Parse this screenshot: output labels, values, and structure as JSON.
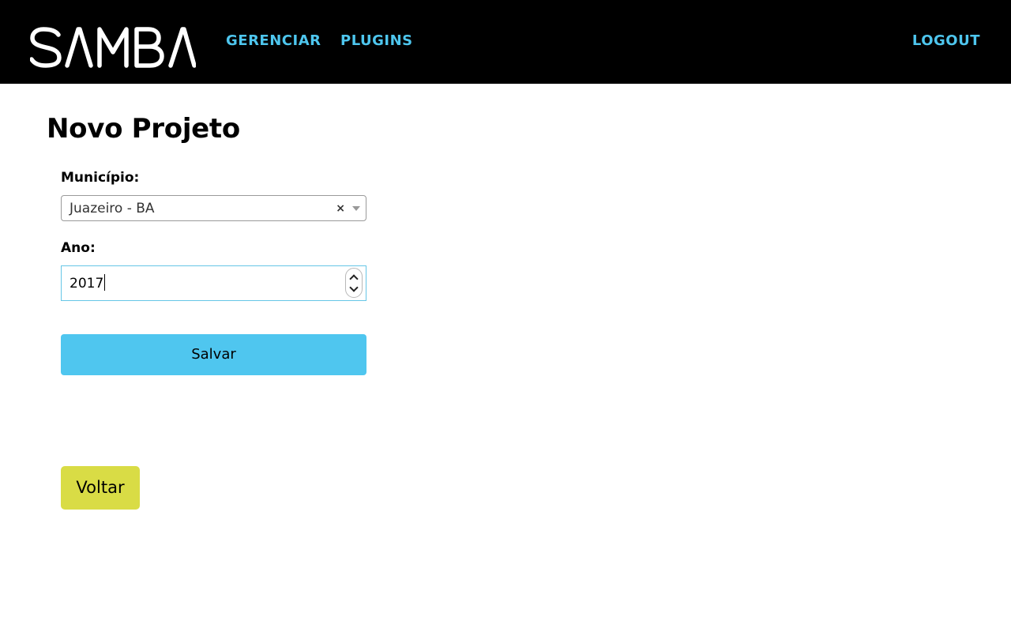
{
  "nav": {
    "logo_text": "SAMBA",
    "links": [
      {
        "label": "GERENCIAR"
      },
      {
        "label": "PLUGINS"
      },
      {
        "label": "LOGOUT"
      }
    ]
  },
  "page": {
    "title": "Novo Projeto"
  },
  "form": {
    "municipio": {
      "label": "Município:",
      "selected_value": "Juazeiro - BA",
      "clear_icon": "×"
    },
    "ano": {
      "label": "Ano:",
      "value": "2017"
    },
    "save_label": "Salvar"
  },
  "back_label": "Voltar",
  "colors": {
    "navbar_bg": "#000000",
    "nav_link": "#4ec6ee",
    "save_button": "#4fc6ef",
    "back_button": "#d9dc45",
    "input_focus_border": "#66c6e6"
  },
  "icons": {
    "select_clear": "close-icon",
    "select_arrow": "chevron-down-icon",
    "spinner_up": "chevron-up-icon",
    "spinner_down": "chevron-down-icon"
  }
}
